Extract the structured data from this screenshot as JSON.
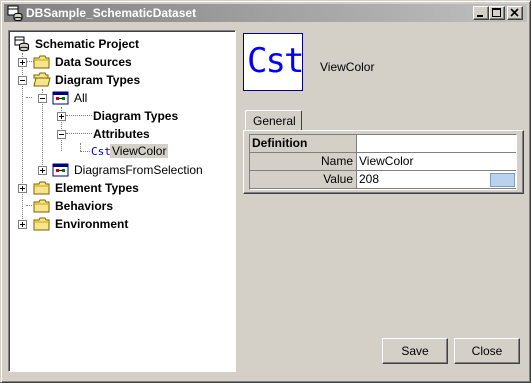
{
  "window": {
    "title": "DBSample_SchematicDataset"
  },
  "tree": {
    "root": "Schematic Project",
    "data_sources": "Data Sources",
    "diagram_types": "Diagram Types",
    "all": "All",
    "all_diagram_types": "Diagram Types",
    "attributes": "Attributes",
    "viewcolor_prefix": "Cst",
    "viewcolor": "ViewColor",
    "diagrams_from_selection": "DiagramsFromSelection",
    "element_types": "Element Types",
    "behaviors": "Behaviors",
    "environment": "Environment"
  },
  "header": {
    "icon_text": "Cst",
    "name": "ViewColor"
  },
  "tabs": {
    "general": "General"
  },
  "properties": {
    "section": "Definition",
    "name_label": "Name",
    "name_value": "ViewColor",
    "value_label": "Value",
    "value_value": "208",
    "value_color": "#b9d3ee"
  },
  "buttons": {
    "save": "Save",
    "close": "Close"
  }
}
